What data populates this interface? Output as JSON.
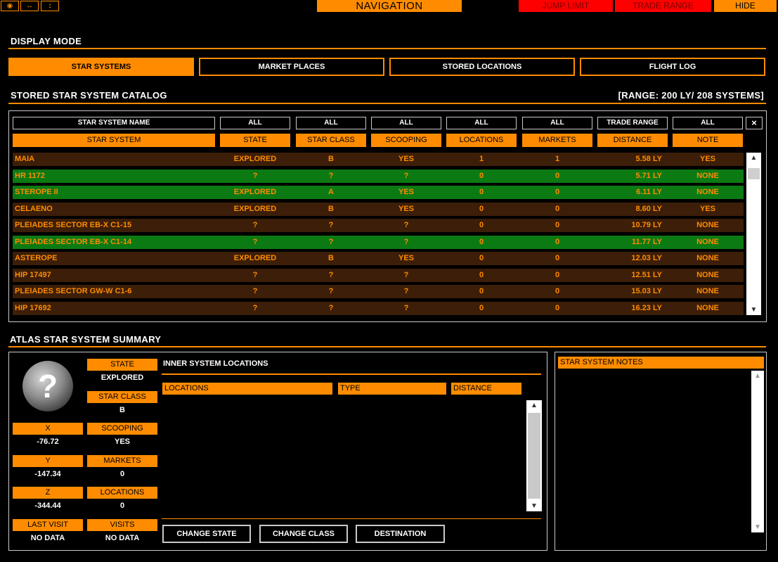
{
  "topbar": {
    "icons": [
      "eye-icon",
      "horizontal-arrows-icon",
      "vertical-arrows-icon"
    ],
    "icon_glyphs": [
      "◉",
      "↔",
      "↕"
    ],
    "title": "NAVIGATION",
    "jump_limit": "JUMP LIMIT",
    "trade_range": "TRADE RANGE",
    "hide": "HIDE"
  },
  "display_mode": {
    "title": "DISPLAY MODE",
    "buttons": [
      "STAR SYSTEMS",
      "MARKET PLACES",
      "STORED LOCATIONS",
      "FLIGHT LOG"
    ],
    "active": "STAR SYSTEMS"
  },
  "catalog": {
    "title": "STORED STAR SYSTEM CATALOG",
    "range": "[RANGE: 200 LY/ 208 SYSTEMS]",
    "filters": [
      "STAR SYSTEM NAME",
      "ALL",
      "ALL",
      "ALL",
      "ALL",
      "ALL",
      "TRADE RANGE",
      "ALL"
    ],
    "clear": "×",
    "columns": [
      "STAR SYSTEM",
      "STATE",
      "STAR CLASS",
      "SCOOPING",
      "LOCATIONS",
      "MARKETS",
      "DISTANCE",
      "NOTE"
    ],
    "rows": [
      {
        "name": "MAIA",
        "state": "EXPLORED",
        "class": "B",
        "scooping": "YES",
        "locations": "1",
        "markets": "1",
        "distance": "5.58 LY",
        "note": "YES",
        "color": "brown"
      },
      {
        "name": "HR 1172",
        "state": "?",
        "class": "?",
        "scooping": "?",
        "locations": "0",
        "markets": "0",
        "distance": "5.71 LY",
        "note": "NONE",
        "color": "green"
      },
      {
        "name": "STEROPE II",
        "state": "EXPLORED",
        "class": "A",
        "scooping": "YES",
        "locations": "0",
        "markets": "0",
        "distance": "6.11 LY",
        "note": "NONE",
        "color": "green"
      },
      {
        "name": "CELAENO",
        "state": "EXPLORED",
        "class": "B",
        "scooping": "YES",
        "locations": "0",
        "markets": "0",
        "distance": "8.60 LY",
        "note": "YES",
        "color": "brown"
      },
      {
        "name": "PLEIADES SECTOR EB-X C1-15",
        "state": "?",
        "class": "?",
        "scooping": "?",
        "locations": "0",
        "markets": "0",
        "distance": "10.79 LY",
        "note": "NONE",
        "color": "brown"
      },
      {
        "name": "PLEIADES SECTOR EB-X C1-14",
        "state": "?",
        "class": "?",
        "scooping": "?",
        "locations": "0",
        "markets": "0",
        "distance": "11.77 LY",
        "note": "NONE",
        "color": "green"
      },
      {
        "name": "ASTEROPE",
        "state": "EXPLORED",
        "class": "B",
        "scooping": "YES",
        "locations": "0",
        "markets": "0",
        "distance": "12.03 LY",
        "note": "NONE",
        "color": "brown"
      },
      {
        "name": "HIP 17497",
        "state": "?",
        "class": "?",
        "scooping": "?",
        "locations": "0",
        "markets": "0",
        "distance": "12.51 LY",
        "note": "NONE",
        "color": "brown"
      },
      {
        "name": "PLEIADES SECTOR GW-W C1-6",
        "state": "?",
        "class": "?",
        "scooping": "?",
        "locations": "0",
        "markets": "0",
        "distance": "15.03 LY",
        "note": "NONE",
        "color": "brown"
      },
      {
        "name": "HIP 17692",
        "state": "?",
        "class": "?",
        "scooping": "?",
        "locations": "0",
        "markets": "0",
        "distance": "16.23 LY",
        "note": "NONE",
        "color": "brown"
      }
    ]
  },
  "summary": {
    "title": "ATLAS STAR SYSTEM SUMMARY",
    "avatar": "?",
    "fields": {
      "state": {
        "label": "STATE",
        "value": "EXPLORED"
      },
      "star_class": {
        "label": "STAR CLASS",
        "value": "B"
      },
      "x": {
        "label": "X",
        "value": "-76.72"
      },
      "scooping": {
        "label": "SCOOPING",
        "value": "YES"
      },
      "y": {
        "label": "Y",
        "value": "-147.34"
      },
      "markets": {
        "label": "MARKETS",
        "value": "0"
      },
      "z": {
        "label": "Z",
        "value": "-344.44"
      },
      "locations": {
        "label": "LOCATIONS",
        "value": "0"
      },
      "last_visit": {
        "label": "LAST VISIT",
        "value": "NO DATA"
      },
      "visits": {
        "label": "VISITS",
        "value": "NO DATA"
      }
    },
    "inner_title": "INNER SYSTEM LOCATIONS",
    "loc_columns": [
      "LOCATIONS",
      "TYPE",
      "DISTANCE"
    ],
    "buttons": [
      "CHANGE STATE",
      "CHANGE CLASS",
      "DESTINATION"
    ],
    "notes_title": "STAR SYSTEM NOTES"
  },
  "scroll_glyphs": {
    "up": "▲",
    "down": "▼"
  }
}
